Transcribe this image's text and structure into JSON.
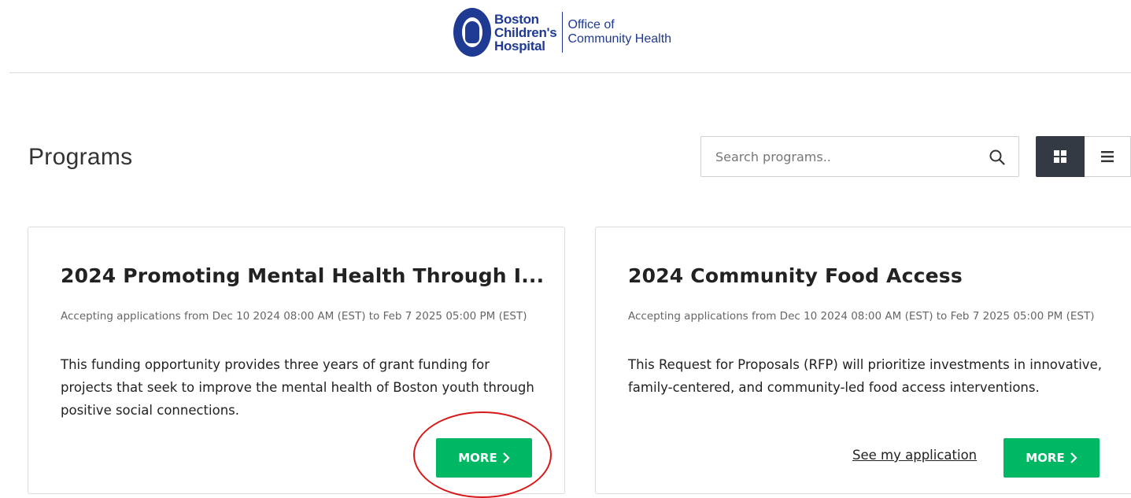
{
  "header": {
    "org_name_lines": [
      "Boston",
      "Children's",
      "Hospital"
    ],
    "office_name_lines": [
      "Office of",
      "Community Health"
    ],
    "brand_color": "#1f3a93"
  },
  "page": {
    "title": "Programs"
  },
  "search": {
    "placeholder": "Search programs..",
    "value": "",
    "icon": "search-icon"
  },
  "view_toggle": {
    "grid_icon": "grid-view-icon",
    "list_icon": "list-view-icon",
    "active": "grid",
    "active_color": "#333a44"
  },
  "programs": [
    {
      "title": "2024 Promoting Mental Health Through I...",
      "dates": "Accepting applications from Dec 10 2024 08:00 AM (EST) to Feb 7 2025 05:00 PM (EST)",
      "description": "This funding opportunity provides three years of grant funding for projects that seek to improve the mental health of Boston youth through positive social connections.",
      "more_label": "MORE",
      "secondary_link": ""
    },
    {
      "title": "2024 Community Food Access",
      "dates": "Accepting applications from Dec 10 2024 08:00 AM (EST) to Feb 7 2025 05:00 PM (EST)",
      "description": "This Request for Proposals (RFP) will prioritize investments in innovative, family-centered, and community-led food access interventions.",
      "more_label": "MORE",
      "secondary_link": "See my application"
    }
  ],
  "colors": {
    "button_green": "#00b863",
    "annotation_red": "#d81818"
  }
}
